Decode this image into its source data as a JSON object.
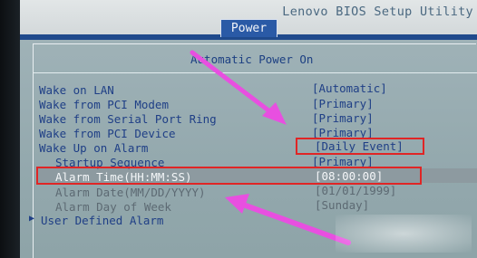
{
  "app": {
    "title": "Lenovo BIOS Setup Utility",
    "tabs": [
      {
        "label": "Power",
        "active": true
      }
    ]
  },
  "panel": {
    "title": "Automatic Power On",
    "items": [
      {
        "label": "Wake on LAN",
        "value": "[Automatic]",
        "state": "normal"
      },
      {
        "label": "Wake from PCI Modem",
        "value": "[Primary]",
        "state": "normal"
      },
      {
        "label": "Wake from Serial Port Ring",
        "value": "[Primary]",
        "state": "normal"
      },
      {
        "label": "Wake from PCI Device",
        "value": "[Primary]",
        "state": "normal"
      },
      {
        "label": "Wake Up on Alarm",
        "value": "[Daily Event]",
        "state": "normal"
      },
      {
        "label": "Startup Sequence",
        "value": "[Primary]",
        "state": "normal"
      },
      {
        "label": "Alarm Time(HH:MM:SS)",
        "value": "[08:00:00]",
        "state": "selected"
      },
      {
        "label": "Alarm Date(MM/DD/YYYY)",
        "value": "[01/01/1999]",
        "state": "disabled"
      },
      {
        "label": "Alarm Day of Week",
        "value": "[Sunday]",
        "state": "disabled"
      }
    ],
    "submenu": {
      "marker": "▶",
      "label": "User Defined Alarm"
    }
  },
  "annotations": {
    "box_color": "#e02525",
    "arrow_color": "#e84fe0"
  }
}
